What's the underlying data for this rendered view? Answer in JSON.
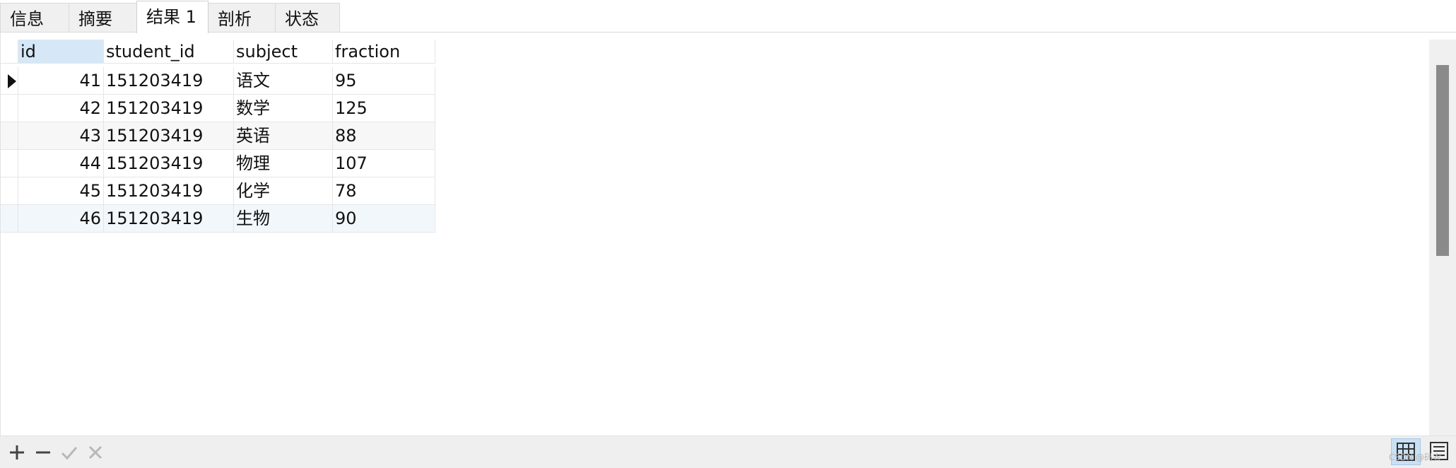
{
  "tabs": [
    {
      "label": "信息",
      "active": false
    },
    {
      "label": "摘要",
      "active": false
    },
    {
      "label": "结果 1",
      "active": true
    },
    {
      "label": "剖析",
      "active": false
    },
    {
      "label": "状态",
      "active": false
    }
  ],
  "grid": {
    "columns": [
      "id",
      "student_id",
      "subject",
      "fraction"
    ],
    "rows": [
      {
        "id": "41",
        "student_id": "151203419",
        "subject": "语文",
        "fraction": "95"
      },
      {
        "id": "42",
        "student_id": "151203419",
        "subject": "数学",
        "fraction": "125"
      },
      {
        "id": "43",
        "student_id": "151203419",
        "subject": "英语",
        "fraction": "88"
      },
      {
        "id": "44",
        "student_id": "151203419",
        "subject": "物理",
        "fraction": "107"
      },
      {
        "id": "45",
        "student_id": "151203419",
        "subject": "化学",
        "fraction": "78"
      },
      {
        "id": "46",
        "student_id": "151203419",
        "subject": "生物",
        "fraction": "90"
      }
    ],
    "current_row_index": 0
  },
  "toolbar": {
    "icons": [
      "plus-icon",
      "minus-icon",
      "check-icon",
      "x-icon"
    ],
    "view_icons": [
      "grid-view-icon",
      "form-view-icon"
    ]
  },
  "watermark": "CSDN @码农",
  "colors": {
    "header_selected": "#d6e8f7",
    "row_alt": "#f7f7f7",
    "row_selected": "#f2f7fc",
    "scroll_thumb": "#8a8a8a",
    "toolbar_bg": "#efefef"
  }
}
